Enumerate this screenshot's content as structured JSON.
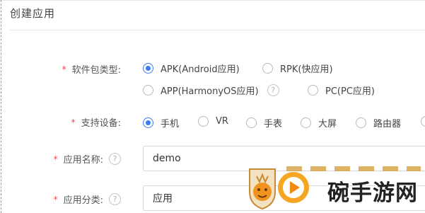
{
  "page": {
    "title": "创建应用"
  },
  "form": {
    "package_type": {
      "label": "软件包类型:",
      "options": [
        "APK(Android应用)",
        "RPK(快应用)",
        "APP(HarmonyOS应用)",
        "PC(PC应用)"
      ],
      "selected": "APK(Android应用)"
    },
    "devices": {
      "label": "支持设备:",
      "options": [
        "手机",
        "VR",
        "手表",
        "大屏",
        "路由器"
      ],
      "selected": "手机"
    },
    "app_name": {
      "label": "应用名称:",
      "value": "demo"
    },
    "category": {
      "label": "应用分类:",
      "value": "应用"
    }
  },
  "watermark": {
    "text": "碗手游网"
  },
  "icons": {
    "help": "question-circle-icon",
    "radio": "radio-icon"
  },
  "colors": {
    "accent": "#3a7cf0",
    "required": "#e5484d"
  }
}
